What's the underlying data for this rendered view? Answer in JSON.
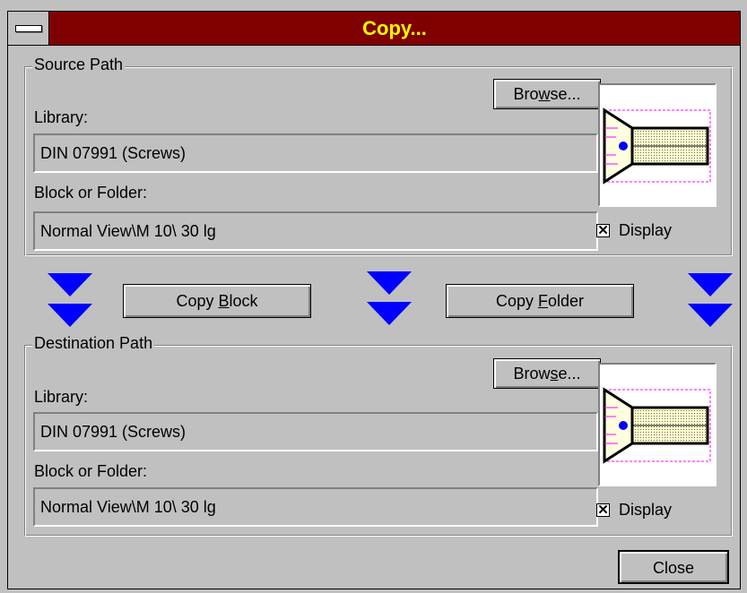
{
  "window": {
    "title": "Copy..."
  },
  "source": {
    "group_label": "Source Path",
    "browse_label": "Browse...",
    "library_label": "Library:",
    "library_value": "DIN 07991 (Screws)",
    "block_label": "Block or Folder:",
    "block_value": "Normal View\\M 10\\ 30 lg",
    "display_label": "Display",
    "display_checked": true
  },
  "actions": {
    "copy_block_label": "Copy Block",
    "copy_folder_label": "Copy Folder"
  },
  "destination": {
    "group_label": "Destination Path",
    "browse_label": "Browse...",
    "library_label": "Library:",
    "library_value": "DIN 07991 (Screws)",
    "block_label": "Block or Folder:",
    "block_value": "Normal View\\M 10\\ 30 lg",
    "display_label": "Display",
    "display_checked": true
  },
  "footer": {
    "close_label": "Close"
  },
  "colors": {
    "title_bg": "#800000",
    "title_text": "#ffff00",
    "arrow": "#0000ff",
    "dialog_bg": "#c0c0c0"
  },
  "icons": {
    "system_menu": "system-menu-icon",
    "arrow": "down-arrow-icon",
    "preview": "screw-drawing-icon",
    "checkbox": "checkbox-checked-icon"
  }
}
